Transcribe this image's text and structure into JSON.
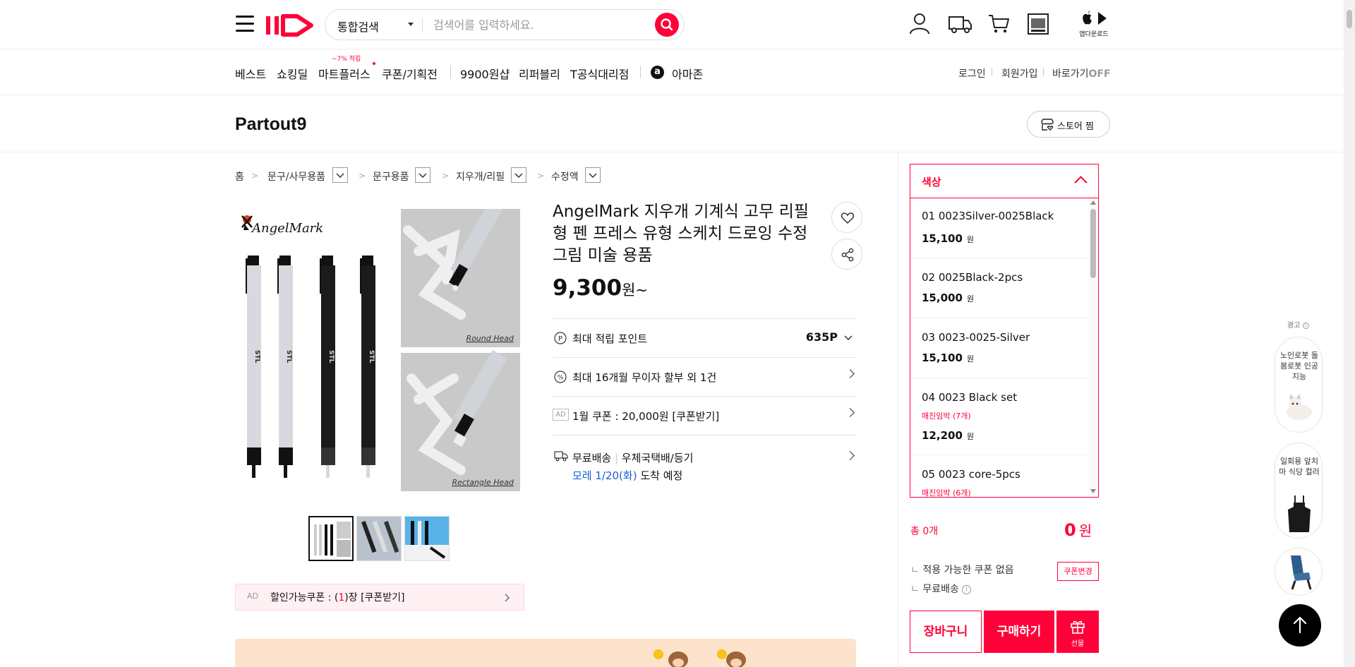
{
  "header": {
    "search_type": "통합검색",
    "search_placeholder": "검색어를 입력하세요.",
    "app_download": "앱다운로드"
  },
  "nav": {
    "items": [
      "베스트",
      "쇼킹딜",
      "마트플러스",
      "쿠폰/기획전",
      "9900원샵",
      "리퍼블리",
      "T공식대리점",
      "아마존"
    ],
    "mart_badge": "~7% 적립",
    "login": "로그인",
    "join": "회원가입",
    "shortcut": "바로가기",
    "shortcut_state": "OFF"
  },
  "store": {
    "name": "Partout9",
    "like_label": "스토어 찜"
  },
  "breadcrumb": [
    "홈",
    "문구/사무용품",
    "문구용품",
    "지우개/리필",
    "수정액"
  ],
  "gallery": {
    "brand": "AngelMark",
    "round_head": "Round Head",
    "rectangle_head": "Rectangle Head",
    "pen_label": "STL"
  },
  "coupon_strip": {
    "ad": "AD",
    "prefix": "할인가능쿠폰 : (",
    "count": "1",
    "suffix": ")장 [쿠폰받기]"
  },
  "product": {
    "title": "AngelMark 지우개 기계식 고무 리필형 펜 프레스 유형 스케치 드로잉 수정 그림 미술 용품",
    "price": "9,300",
    "price_unit": "원~",
    "points_label": "최대 적립 포인트",
    "points_value": "635P",
    "installment": "최대 16개월 무이자 할부 외 1건",
    "coupon_ad": "AD",
    "coupon_text": "1월 쿠폰 : 20,000원 [쿠폰받기]",
    "shipping_type": "무료배송",
    "shipping_method": "우체국택배/등기",
    "arrival_date": "모레 1/20(화)",
    "arrival_suffix": "도착 예정"
  },
  "options": {
    "header": "색상",
    "items": [
      {
        "name": "01 0023Silver-0025Black",
        "stock": "",
        "price": "15,100",
        "unit": "원"
      },
      {
        "name": "02 0025Black-2pcs",
        "stock": "",
        "price": "15,000",
        "unit": "원"
      },
      {
        "name": "03 0023-0025-Silver",
        "stock": "",
        "price": "15,100",
        "unit": "원"
      },
      {
        "name": "04 0023 Black set",
        "stock": "매진임박 (7개)",
        "price": "12,200",
        "unit": "원"
      },
      {
        "name": "05 0023 core-5pcs",
        "stock": "매진임박 (6개)",
        "price": "",
        "unit": ""
      }
    ]
  },
  "order": {
    "total_label": "총 0개",
    "total_price": "0",
    "total_unit": "원",
    "no_coupon": "적용 가능한 쿠폰 없음",
    "coupon_change": "쿠폰변경",
    "free_shipping": "무료배송",
    "cart": "장바구니",
    "buy": "구매하기",
    "gift": "선물"
  },
  "ads": {
    "label": "광고",
    "card1": "노인로봇 돌봄로봇 인공지능",
    "card2": "일회용 앞치마 식당 컬러"
  },
  "colors": {
    "accent": "#ff0038",
    "promo_bg": "#fde3cc",
    "link_blue": "#1a5fd6"
  }
}
